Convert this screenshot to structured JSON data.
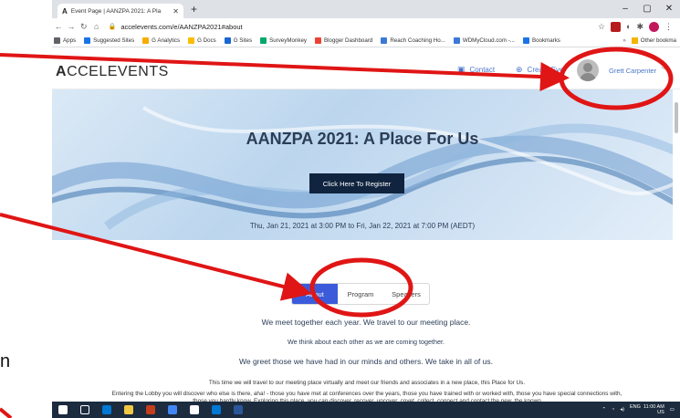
{
  "outside": {
    "left_stub_text": "n"
  },
  "browser": {
    "tab_title": "Event Page | AANZPA 2021: A Pla",
    "tab_favicon": "A",
    "url": "accelevents.com/e/AANZPA2021#about",
    "bookmarks": [
      "Apps",
      "Suggested Sites",
      "G Analytics",
      "G Docs",
      "G Sites",
      "SurveyMonkey",
      "Blogger Dashboard",
      "Reach Coaching Ho...",
      "WDMyCloud.com -...",
      "Bookmarks"
    ],
    "bookmark_colors": [
      "#5f6368",
      "#1a73e8",
      "#f9ab00",
      "#fbbc04",
      "#1967d2",
      "#00a86b",
      "#ea4335",
      "#3c78d8",
      "#3c78d8",
      "#1a73e8"
    ],
    "other_bookmarks": "Other bookma"
  },
  "site": {
    "logo_bold": "A",
    "logo_rest": "CCELEVENTS",
    "contact": "Contact",
    "create_event": "Create Eve",
    "user_name": "Grett Carpenter"
  },
  "hero": {
    "title": "AANZPA 2021: A Place For Us",
    "register": "Click Here To Register",
    "date": "Thu, Jan 21, 2021 at 3:00 PM to Fri, Jan 22, 2021 at 7:00 PM (AEDT)"
  },
  "tabs": [
    {
      "label": "About",
      "active": true
    },
    {
      "label": "Program",
      "active": false
    },
    {
      "label": "Speakers",
      "active": false
    }
  ],
  "about": {
    "line1": "We meet together each year. We travel to our meeting place.",
    "line2": "We think about each other as we are coming together.",
    "line3": "We greet those we have had in our minds and others. We take in all of us.",
    "small1": "This time we will travel to our meeting place virtually and meet our friends and associates in a new place, this Place for Us.",
    "small2": "Entering the Lobby you will discover who else is there, aha! - those you have met at conferences over the years, those you have trained with or worked with, those you have special connections with, those you hardly know. Exploring this place, you can discover, recover, uncover, covet, collect, connect and contact the new, the known"
  },
  "taskbar": {
    "icon_colors": [
      "#ffffff",
      "#ffffff",
      "#0078d4",
      "#f2c744",
      "#c43e1c",
      "#4285f4",
      "#ffffff",
      "#0078d4",
      "#2b579a"
    ],
    "lang": "ENG",
    "locale": "US",
    "time": "11:00 AM"
  },
  "colors": {
    "accent": "#3b5bdb",
    "annotation": "#e01515",
    "link": "#4a76c9"
  }
}
